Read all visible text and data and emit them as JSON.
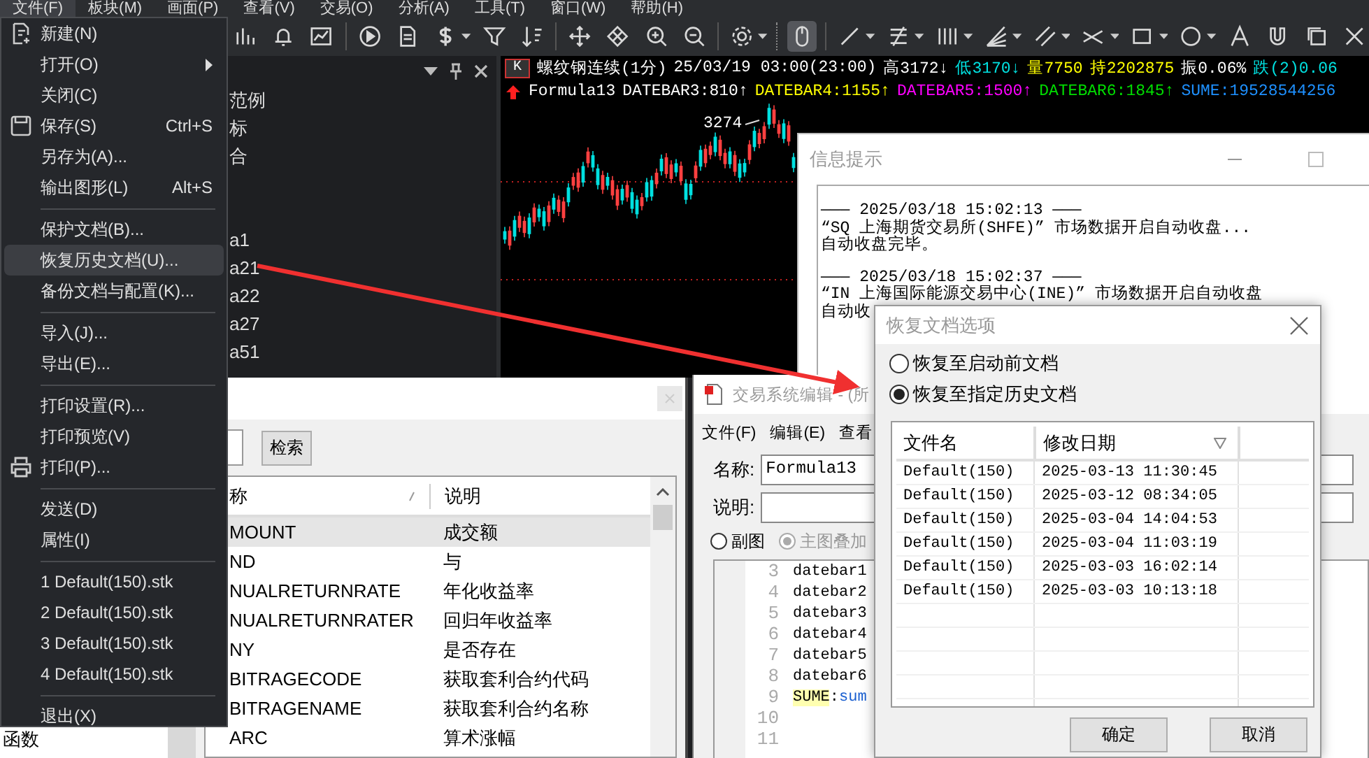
{
  "menu_bar": [
    {
      "label": "文件(F)",
      "selected": true
    },
    {
      "label": "板块(M)",
      "selected": false
    },
    {
      "label": "画面(P)",
      "selected": false
    },
    {
      "label": "查看(V)",
      "selected": false
    },
    {
      "label": "交易(O)",
      "selected": false
    },
    {
      "label": "分析(A)",
      "selected": false
    },
    {
      "label": "工具(T)",
      "selected": false
    },
    {
      "label": "窗口(W)",
      "selected": false
    },
    {
      "label": "帮助(H)",
      "selected": false
    }
  ],
  "toolbar": [
    {
      "selected": false
    },
    {
      "selected": false
    },
    {
      "selected": false
    },
    {
      "selected": false
    },
    {
      "selected": false
    },
    {
      "selected": false
    },
    {
      "selected": false
    },
    {
      "selected": false
    },
    {
      "selected": false
    },
    {
      "selected": false
    },
    {
      "selected": false
    },
    {
      "selected": false
    },
    {
      "selected": false
    },
    {
      "selected": true
    },
    {
      "selected": false
    },
    {
      "selected": false
    },
    {
      "selected": false
    },
    {
      "selected": false
    },
    {
      "selected": false
    },
    {
      "selected": false
    },
    {
      "selected": false
    },
    {
      "selected": false
    },
    {
      "selected": false
    },
    {
      "selected": false
    },
    {
      "selected": false
    },
    {
      "selected": false
    }
  ],
  "side_panel": {
    "items": [
      {
        "label": "范例"
      },
      {
        "label": "标"
      },
      {
        "label": "合"
      },
      {
        "label": "a1"
      },
      {
        "label": "a21"
      },
      {
        "label": "a22"
      },
      {
        "label": "a27"
      },
      {
        "label": "a51"
      }
    ]
  },
  "chart": {
    "symbol_badge": "K",
    "quote": [
      {
        "text": "螺纹钢连续(1分)",
        "color": "#ffffff"
      },
      {
        "text": "25/03/19 03:00(23:00)",
        "color": "#ffffff"
      },
      {
        "text": "高3172↓",
        "color": "#ffffff"
      },
      {
        "text": "低3170↓",
        "color": "#00e0e0"
      },
      {
        "text": "量7750",
        "color": "#ffff00"
      },
      {
        "text": "持2202875",
        "color": "#ffff00"
      },
      {
        "text": "振0.06%",
        "color": "#ffffff"
      },
      {
        "text": "跌(2)0.06",
        "color": "#00e0e0"
      }
    ],
    "indicators": [
      {
        "text": "Formula13",
        "color": "#ffffff"
      },
      {
        "text": "DATEBAR3:810↑",
        "color": "#ffffff"
      },
      {
        "text": "DATEBAR4:1155↑",
        "color": "#ffff00"
      },
      {
        "text": "DATEBAR5:1500↑",
        "color": "#ff00ff"
      },
      {
        "text": "DATEBAR6:1845↑",
        "color": "#00dd00"
      },
      {
        "text": "SUME:19528544256",
        "color": "#1e90ff"
      }
    ],
    "peak_label": "3274"
  },
  "info_window": {
    "title": "信息提示",
    "lines": [
      "——— 2025/03/18 15:02:13 ———",
      "“SQ 上海期货交易所(SHFE)” 市场数据开启自动收盘...",
      "自动收盘完毕。",
      "——— 2025/03/18 15:02:37 ———",
      "“IN 上海国际能源交易中心(INE)” 市场数据开启自动收盘",
      "自动收"
    ]
  },
  "formula_list": {
    "search_button": "检索",
    "columns": [
      "称",
      "说明"
    ],
    "rows": [
      {
        "name": "MOUNT",
        "description": "成交额",
        "selected": true
      },
      {
        "name": "ND",
        "description": "与",
        "selected": false
      },
      {
        "name": "NUALRETURNRATE",
        "description": "年化收益率",
        "selected": false
      },
      {
        "name": "NUALRETURNRATER",
        "description": "回归年收益率",
        "selected": false
      },
      {
        "name": "NY",
        "description": "是否存在",
        "selected": false
      },
      {
        "name": "BITRAGECODE",
        "description": "获取套利合约代码",
        "selected": false
      },
      {
        "name": "BITRAGENAME",
        "description": "获取套利合约名称",
        "selected": false
      },
      {
        "name": "ARC",
        "description": "算术涨幅",
        "selected": false
      }
    ]
  },
  "left_list": {
    "items": [
      "函数"
    ]
  },
  "editor": {
    "title": "交易系统编辑 - (所",
    "menus": [
      "文件(F)",
      "编辑(E)",
      "查看"
    ],
    "name_label": "名称:",
    "name_value": "Formula13",
    "desc_label": "说明:",
    "radios": [
      {
        "label": "副图",
        "selected": false,
        "disabled": false
      },
      {
        "label": "主图叠加",
        "selected": true,
        "disabled": true
      }
    ],
    "code_lines": [
      {
        "number": "3",
        "tokens": [
          {
            "text": "datebar1",
            "kind": "plain"
          }
        ]
      },
      {
        "number": "4",
        "tokens": [
          {
            "text": "datebar2",
            "kind": "plain"
          }
        ]
      },
      {
        "number": "5",
        "tokens": [
          {
            "text": "datebar3",
            "kind": "plain"
          }
        ]
      },
      {
        "number": "6",
        "tokens": [
          {
            "text": "datebar4",
            "kind": "plain"
          }
        ]
      },
      {
        "number": "7",
        "tokens": [
          {
            "text": "datebar5",
            "kind": "plain"
          }
        ]
      },
      {
        "number": "8",
        "tokens": [
          {
            "text": "datebar6",
            "kind": "plain"
          }
        ]
      },
      {
        "number": "9",
        "tokens": [
          {
            "text": "SUME",
            "kind": "highlight"
          },
          {
            "text": ":",
            "kind": "plain"
          },
          {
            "text": "sum",
            "kind": "function"
          }
        ]
      },
      {
        "number": "10"
      },
      {
        "number": "11"
      }
    ]
  },
  "restore_dialog": {
    "title": "恢复文档选项",
    "options": [
      {
        "label": "恢复至启动前文档",
        "selected": false
      },
      {
        "label": "恢复至指定历史文档",
        "selected": true
      }
    ],
    "columns": [
      "文件名",
      "修改日期"
    ],
    "rows": [
      {
        "name": "Default(150)",
        "date": "2025-03-13 11:30:45"
      },
      {
        "name": "Default(150)",
        "date": "2025-03-12 08:34:05"
      },
      {
        "name": "Default(150)",
        "date": "2025-03-04 14:04:53"
      },
      {
        "name": "Default(150)",
        "date": "2025-03-04 11:03:19"
      },
      {
        "name": "Default(150)",
        "date": "2025-03-03 16:02:14"
      },
      {
        "name": "Default(150)",
        "date": "2025-03-03 10:13:18"
      }
    ],
    "buttons": [
      "确定",
      "取消"
    ]
  },
  "file_menu": {
    "items": [
      {
        "kind": "item",
        "label": "新建(N)",
        "selected": false,
        "submenu": false
      },
      {
        "kind": "item",
        "label": "打开(O)",
        "selected": false,
        "submenu": true
      },
      {
        "kind": "item",
        "label": "关闭(C)",
        "selected": false,
        "submenu": false
      },
      {
        "kind": "item",
        "label": "保存(S)",
        "shortcut": "Ctrl+S",
        "selected": false,
        "submenu": false
      },
      {
        "kind": "item",
        "label": "另存为(A)...",
        "selected": false,
        "submenu": false
      },
      {
        "kind": "item",
        "label": "输出图形(L)",
        "shortcut": "Alt+S",
        "selected": false,
        "submenu": false
      },
      {
        "kind": "separator"
      },
      {
        "kind": "item",
        "label": "保护文档(B)...",
        "selected": false,
        "submenu": false
      },
      {
        "kind": "item",
        "label": "恢复历史文档(U)...",
        "selected": true,
        "submenu": false
      },
      {
        "kind": "item",
        "label": "备份文档与配置(K)...",
        "selected": false,
        "submenu": false
      },
      {
        "kind": "separator"
      },
      {
        "kind": "item",
        "label": "导入(J)...",
        "selected": false,
        "submenu": false
      },
      {
        "kind": "item",
        "label": "导出(E)...",
        "selected": false,
        "submenu": false
      },
      {
        "kind": "separator"
      },
      {
        "kind": "item",
        "label": "打印设置(R)...",
        "selected": false,
        "submenu": false
      },
      {
        "kind": "item",
        "label": "打印预览(V)",
        "selected": false,
        "submenu": false
      },
      {
        "kind": "item",
        "label": "打印(P)...",
        "selected": false,
        "submenu": false
      },
      {
        "kind": "separator"
      },
      {
        "kind": "item",
        "label": "发送(D)",
        "selected": false,
        "submenu": false
      },
      {
        "kind": "item",
        "label": "属性(I)",
        "selected": false,
        "submenu": false
      },
      {
        "kind": "separator"
      },
      {
        "kind": "item",
        "label": "1 Default(150).stk",
        "selected": false,
        "submenu": false
      },
      {
        "kind": "item",
        "label": "2 Default(150).stk",
        "selected": false,
        "submenu": false
      },
      {
        "kind": "item",
        "label": "3 Default(150).stk",
        "selected": false,
        "submenu": false
      },
      {
        "kind": "item",
        "label": "4 Default(150).stk",
        "selected": false,
        "submenu": false
      },
      {
        "kind": "separator"
      },
      {
        "kind": "item",
        "label": "退出(X)",
        "selected": false,
        "submenu": false
      }
    ]
  }
}
